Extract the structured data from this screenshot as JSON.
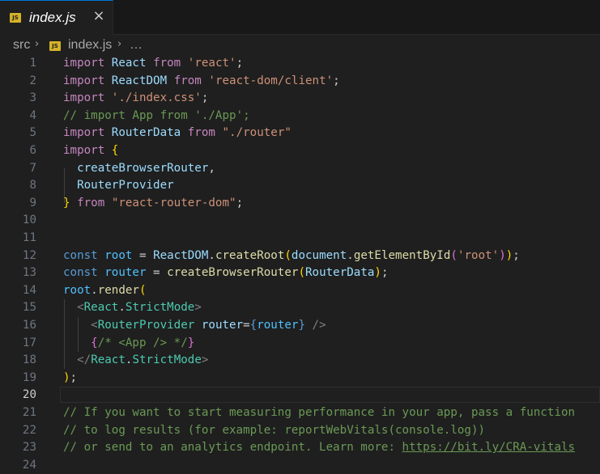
{
  "tab": {
    "title": "index.js",
    "icon_label": "JS",
    "close_glyph": "×"
  },
  "breadcrumb": {
    "folder": "src",
    "file": "index.js",
    "more": "…"
  },
  "editor": {
    "active_line": 20,
    "lines": [
      {
        "n": "1",
        "tokens": [
          [
            "imp",
            "import"
          ],
          [
            "pun",
            " "
          ],
          [
            "var",
            "React"
          ],
          [
            "pun",
            " "
          ],
          [
            "imp",
            "from"
          ],
          [
            "pun",
            " "
          ],
          [
            "str",
            "'react'"
          ],
          [
            "pun",
            ";"
          ]
        ]
      },
      {
        "n": "2",
        "tokens": [
          [
            "imp",
            "import"
          ],
          [
            "pun",
            " "
          ],
          [
            "var",
            "ReactDOM"
          ],
          [
            "pun",
            " "
          ],
          [
            "imp",
            "from"
          ],
          [
            "pun",
            " "
          ],
          [
            "str",
            "'react-dom/client'"
          ],
          [
            "pun",
            ";"
          ]
        ]
      },
      {
        "n": "3",
        "tokens": [
          [
            "imp",
            "import"
          ],
          [
            "pun",
            " "
          ],
          [
            "str",
            "'./index.css'"
          ],
          [
            "pun",
            ";"
          ]
        ]
      },
      {
        "n": "4",
        "tokens": [
          [
            "com",
            "// import App from './App';"
          ]
        ]
      },
      {
        "n": "5",
        "tokens": [
          [
            "imp",
            "import"
          ],
          [
            "pun",
            " "
          ],
          [
            "var",
            "RouterData"
          ],
          [
            "pun",
            " "
          ],
          [
            "imp",
            "from"
          ],
          [
            "pun",
            " "
          ],
          [
            "str",
            "\"./router\""
          ]
        ]
      },
      {
        "n": "6",
        "tokens": [
          [
            "imp",
            "import"
          ],
          [
            "pun",
            " "
          ],
          [
            "br1",
            "{"
          ]
        ]
      },
      {
        "n": "7",
        "tokens": [
          [
            "pun",
            "  "
          ],
          [
            "var",
            "createBrowserRouter"
          ],
          [
            "pun",
            ","
          ]
        ]
      },
      {
        "n": "8",
        "tokens": [
          [
            "pun",
            "  "
          ],
          [
            "var",
            "RouterProvider"
          ]
        ]
      },
      {
        "n": "9",
        "tokens": [
          [
            "br1",
            "}"
          ],
          [
            "pun",
            " "
          ],
          [
            "imp",
            "from"
          ],
          [
            "pun",
            " "
          ],
          [
            "str",
            "\"react-router-dom\""
          ],
          [
            "pun",
            ";"
          ]
        ]
      },
      {
        "n": "10",
        "tokens": []
      },
      {
        "n": "11",
        "tokens": []
      },
      {
        "n": "12",
        "tokens": [
          [
            "kw",
            "const"
          ],
          [
            "pun",
            " "
          ],
          [
            "const",
            "root"
          ],
          [
            "pun",
            " = "
          ],
          [
            "var",
            "ReactDOM"
          ],
          [
            "pun",
            "."
          ],
          [
            "fn",
            "createRoot"
          ],
          [
            "br1",
            "("
          ],
          [
            "var",
            "document"
          ],
          [
            "pun",
            "."
          ],
          [
            "fn",
            "getElementById"
          ],
          [
            "br2",
            "("
          ],
          [
            "str",
            "'root'"
          ],
          [
            "br2",
            ")"
          ],
          [
            "br1",
            ")"
          ],
          [
            "pun",
            ";"
          ]
        ]
      },
      {
        "n": "13",
        "tokens": [
          [
            "kw",
            "const"
          ],
          [
            "pun",
            " "
          ],
          [
            "const",
            "router"
          ],
          [
            "pun",
            " = "
          ],
          [
            "fn",
            "createBrowserRouter"
          ],
          [
            "br1",
            "("
          ],
          [
            "var",
            "RouterData"
          ],
          [
            "br1",
            ")"
          ],
          [
            "pun",
            ";"
          ]
        ]
      },
      {
        "n": "14",
        "tokens": [
          [
            "const",
            "root"
          ],
          [
            "pun",
            "."
          ],
          [
            "fn",
            "render"
          ],
          [
            "br1",
            "("
          ]
        ]
      },
      {
        "n": "15",
        "tokens": [
          [
            "pun",
            "  "
          ],
          [
            "tag",
            "<"
          ],
          [
            "cls",
            "React"
          ],
          [
            "pun",
            "."
          ],
          [
            "cls",
            "StrictMode"
          ],
          [
            "tag",
            ">"
          ]
        ]
      },
      {
        "n": "16",
        "tokens": [
          [
            "pun",
            "    "
          ],
          [
            "tag",
            "<"
          ],
          [
            "cls",
            "RouterProvider"
          ],
          [
            "pun",
            " "
          ],
          [
            "var",
            "router"
          ],
          [
            "pun",
            "="
          ],
          [
            "kw",
            "{"
          ],
          [
            "const",
            "router"
          ],
          [
            "kw",
            "}"
          ],
          [
            "pun",
            " "
          ],
          [
            "tag",
            "/>"
          ]
        ]
      },
      {
        "n": "17",
        "tokens": [
          [
            "pun",
            "    "
          ],
          [
            "br2",
            "{"
          ],
          [
            "com",
            "/* <App /> */"
          ],
          [
            "br2",
            "}"
          ]
        ]
      },
      {
        "n": "18",
        "tokens": [
          [
            "pun",
            "  "
          ],
          [
            "tag",
            "</"
          ],
          [
            "cls",
            "React"
          ],
          [
            "pun",
            "."
          ],
          [
            "cls",
            "StrictMode"
          ],
          [
            "tag",
            ">"
          ]
        ]
      },
      {
        "n": "19",
        "tokens": [
          [
            "br1",
            ")"
          ],
          [
            "pun",
            ";"
          ]
        ]
      },
      {
        "n": "20",
        "tokens": []
      },
      {
        "n": "21",
        "tokens": [
          [
            "com",
            "// If you want to start measuring performance in your app, pass a function"
          ]
        ]
      },
      {
        "n": "22",
        "tokens": [
          [
            "com",
            "// to log results (for example: reportWebVitals(console.log))"
          ]
        ]
      },
      {
        "n": "23",
        "tokens": [
          [
            "com",
            "// or send to an analytics endpoint. Learn more: "
          ],
          [
            "link",
            "https://bit.ly/CRA-vitals"
          ]
        ]
      },
      {
        "n": "24",
        "tokens": []
      }
    ]
  }
}
